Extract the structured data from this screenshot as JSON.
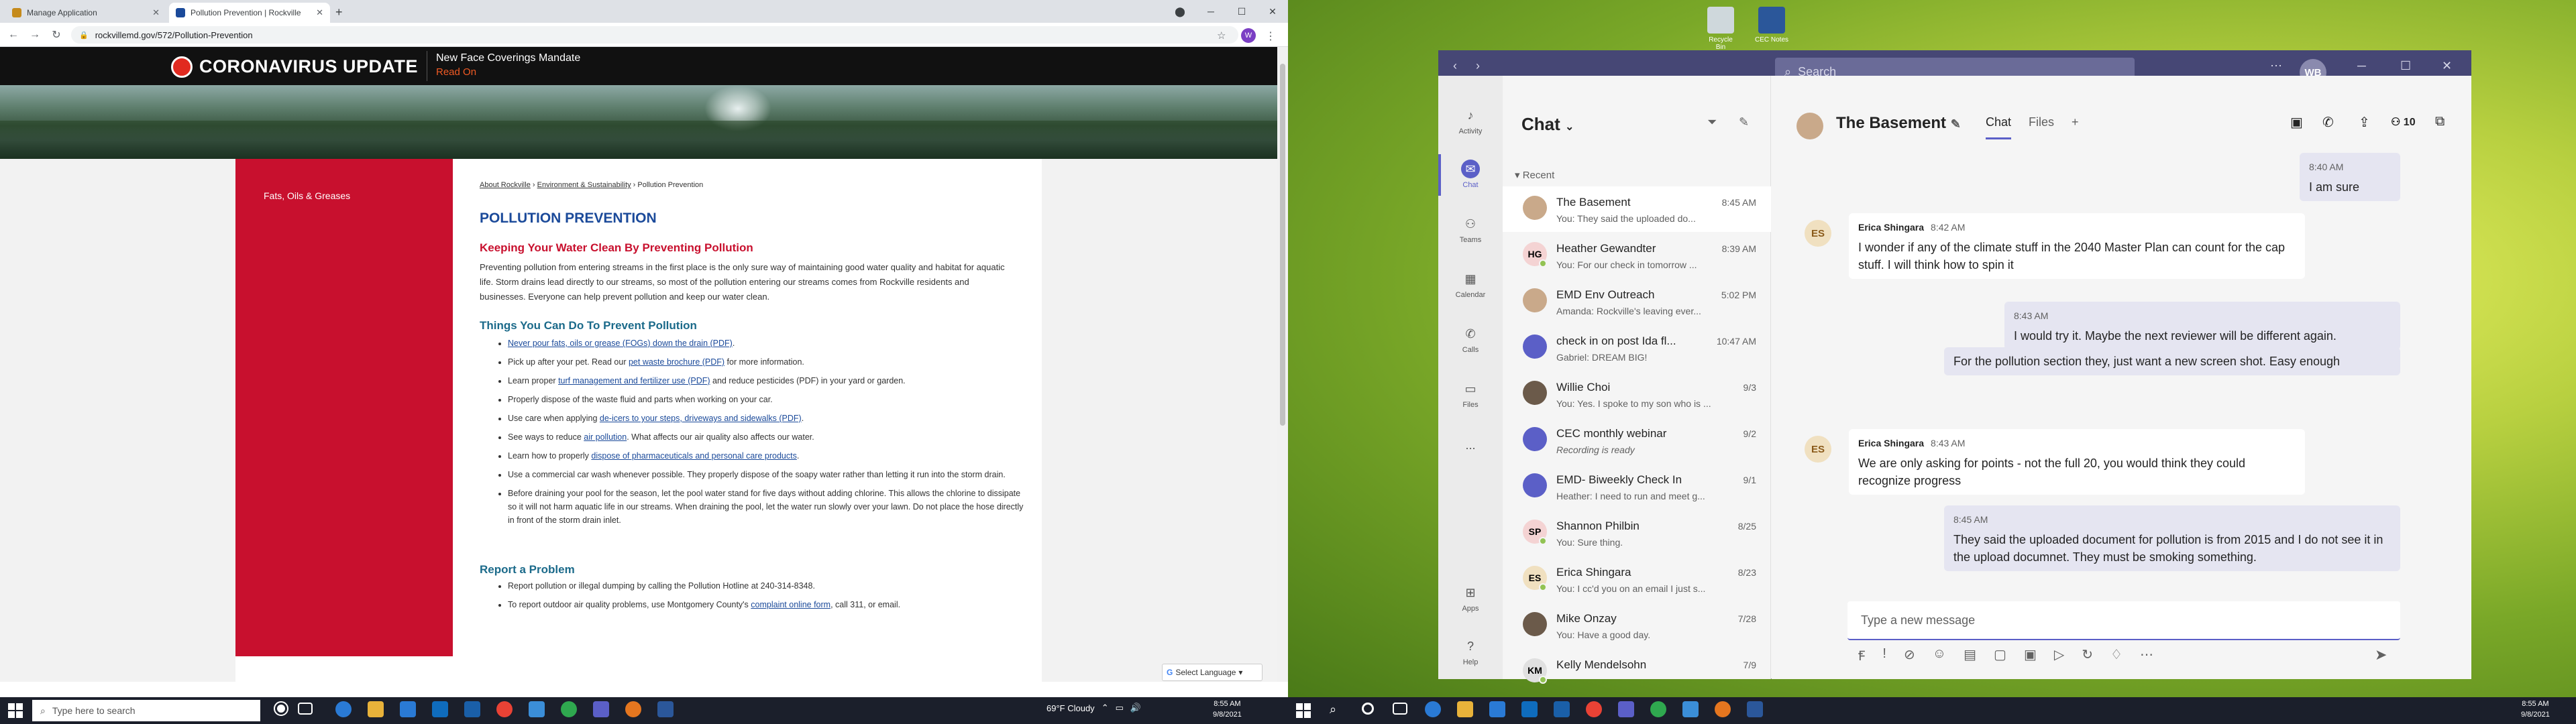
{
  "browser": {
    "tabs": [
      {
        "label": "Manage Application"
      },
      {
        "label": "Pollution Prevention | Rockville"
      }
    ],
    "url": "rockvillemd.gov/572/Pollution-Prevention",
    "profile_initial": "W"
  },
  "covid": {
    "title": "CORONAVIRUS UPDATE",
    "news": "New Face Coverings Mandate",
    "readon": "Read On"
  },
  "site": {
    "sidenav_item": "Fats, Oils & Greases",
    "breadcrumb": [
      "About Rockville",
      "Environment & Sustainability",
      "Pollution Prevention"
    ],
    "page_title": "POLLUTION PREVENTION",
    "subhead1": "Keeping Your Water Clean By Preventing Pollution",
    "intro": "Preventing pollution from entering streams in the first place is the only sure way of maintaining good water quality and habitat for aquatic life. Storm drains lead directly to our streams, so most of the pollution entering our streams comes from Rockville residents and businesses. Everyone can help prevent pollution and keep our water clean.",
    "subhead2": "Things You Can Do To Prevent Pollution",
    "things": [
      {
        "pre": "",
        "link": "Never pour fats, oils or grease (FOGs) down the drain (PDF)",
        "post": "."
      },
      {
        "pre": "Pick up after your pet. Read our ",
        "link": "pet waste brochure (PDF)",
        "post": " for more information."
      },
      {
        "pre": "Learn proper ",
        "link": "turf management and fertilizer use (PDF)",
        "post": " and reduce pesticides (PDF) in your yard or garden."
      },
      {
        "pre": "Properly dispose of the waste fluid and parts when working on your car.",
        "link": "",
        "post": ""
      },
      {
        "pre": "Use care when applying ",
        "link": "de-icers to your steps, driveways and sidewalks (PDF)",
        "post": "."
      },
      {
        "pre": "See ways to reduce ",
        "link": "air pollution",
        "post": ". What affects our air quality also affects our water."
      },
      {
        "pre": "Learn how to properly ",
        "link": "dispose of pharmaceuticals and personal care products",
        "post": "."
      },
      {
        "pre": "Use a commercial car wash whenever possible. They properly dispose of the soapy water rather than letting it run into the storm drain.",
        "link": "",
        "post": ""
      },
      {
        "pre": "Before draining your pool for the season, let the pool water stand for five days without adding chlorine. This allows the chlorine to dissipate so it will not harm aquatic life in our streams. When draining the pool, let the water run slowly over your lawn. Do not place the hose directly in front of the storm drain inlet.",
        "link": "",
        "post": ""
      }
    ],
    "subhead3": "Report a Problem",
    "report": [
      {
        "pre": "Report pollution or illegal dumping by calling the Pollution Hotline at 240-314-8348.",
        "link": "",
        "post": ""
      },
      {
        "pre": "To report outdoor air quality problems, use Montgomery County's ",
        "link": "complaint online form",
        "post": ", call 311, or email."
      }
    ],
    "translate": "Select Language"
  },
  "taskbar_left": {
    "search_placeholder": "Type here to search",
    "weather": "69°F  Cloudy",
    "time": "8:55 AM",
    "date": "9/8/2021"
  },
  "taskbar_right": {
    "time": "8:55 AM",
    "date": "9/8/2021"
  },
  "desktop": {
    "icons": [
      "Recycle Bin",
      "CEC Notes"
    ]
  },
  "teams": {
    "search_placeholder": "Search",
    "avatar_initials": "WB",
    "rail": [
      {
        "label": "Activity",
        "icon": "bell-icon"
      },
      {
        "label": "Chat",
        "icon": "chat-icon"
      },
      {
        "label": "Teams",
        "icon": "teams-icon"
      },
      {
        "label": "Calendar",
        "icon": "calendar-icon"
      },
      {
        "label": "Calls",
        "icon": "phone-icon"
      },
      {
        "label": "Files",
        "icon": "file-icon"
      },
      {
        "label": "...",
        "icon": "more-icon"
      },
      {
        "label": "Apps",
        "icon": "apps-icon"
      },
      {
        "label": "Help",
        "icon": "help-icon"
      }
    ],
    "chat_heading": "Chat",
    "recent_label": "Recent",
    "chats": [
      {
        "name": "The Basement",
        "time": "8:45 AM",
        "preview": "You: They said the uploaded do...",
        "initials": "",
        "color": "#c9a98a"
      },
      {
        "name": "Heather Gewandter",
        "time": "8:39 AM",
        "preview": "You: For our check in tomorrow ...",
        "initials": "HG",
        "color": "#f4d3d3"
      },
      {
        "name": "EMD Env Outreach",
        "time": "5:02 PM",
        "preview": "Amanda: Rockville's leaving ever...",
        "initials": "",
        "color": "#c9a98a"
      },
      {
        "name": "check in on post Ida fl...",
        "time": "10:47 AM",
        "preview": "Gabriel: DREAM BIG!",
        "initials": "",
        "color": "#5b5fc7"
      },
      {
        "name": "Willie Choi",
        "time": "9/3",
        "preview": "You: Yes. I spoke to my son who is ...",
        "initials": "",
        "color": "#6b5a4a"
      },
      {
        "name": "CEC monthly webinar",
        "time": "9/2",
        "preview": "Recording is ready",
        "initials": "",
        "color": "#5b5fc7"
      },
      {
        "name": "EMD- Biweekly Check In",
        "time": "9/1",
        "preview": "Heather: I need to run and meet g...",
        "initials": "",
        "color": "#5b5fc7"
      },
      {
        "name": "Shannon Philbin",
        "time": "8/25",
        "preview": "You: Sure thing.",
        "initials": "SP",
        "color": "#f4d3d3"
      },
      {
        "name": "Erica Shingara",
        "time": "8/23",
        "preview": "You: I cc'd you on an email I just s...",
        "initials": "ES",
        "color": "#f0e0c0"
      },
      {
        "name": "Mike Onzay",
        "time": "7/28",
        "preview": "You: Have a good day.",
        "initials": "",
        "color": "#6b5a4a"
      },
      {
        "name": "Kelly Mendelsohn",
        "time": "7/9",
        "preview": "",
        "initials": "KM",
        "color": "#e0e0e0"
      }
    ],
    "chat_title": "The Basement",
    "tabs": [
      "Chat",
      "Files"
    ],
    "participants": "10",
    "messages": [
      {
        "mine": true,
        "time": "8:40 AM",
        "text": "I am sure"
      },
      {
        "mine": false,
        "author": "Erica Shingara",
        "time": "8:42 AM",
        "text": "I wonder if any of the climate stuff in the 2040 Master Plan can count for the cap stuff. I will think how to spin it"
      },
      {
        "mine": true,
        "time": "8:43 AM",
        "text": "I would try it.  Maybe the next reviewer will be different again."
      },
      {
        "mine": true,
        "time": "",
        "text": "For the pollution section they, just want a new screen shot.  Easy enough"
      },
      {
        "mine": false,
        "author": "Erica Shingara",
        "time": "8:43 AM",
        "text": "We are only asking for  points - not the full 20, you would think they could recognize progress"
      },
      {
        "mine": true,
        "time": "8:45 AM",
        "text": "They said the uploaded document for pollution is from 2015 and I do not see it in the upload documnet.  They must be smoking something."
      }
    ],
    "compose_placeholder": "Type a new message"
  }
}
